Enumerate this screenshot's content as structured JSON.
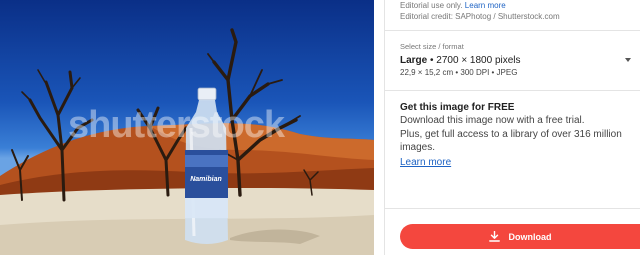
{
  "photo": {
    "watermark_text": "shutterstock",
    "bottle_label": "Namibian",
    "alt": "Water bottle in desert"
  },
  "editorial": {
    "notice": "Editorial use only.",
    "learn_more": "Learn more",
    "credit": "Editorial credit: SAPhotog / Shutterstock.com"
  },
  "size": {
    "label": "Select size / format",
    "name": "Large",
    "pixels": " • 2700 × 1800 pixels",
    "details": "22,9 × 15,2 cm • 300 DPI • JPEG"
  },
  "free": {
    "title": "Get this image for FREE",
    "line1": "Download this image now with a free trial.",
    "line2": "Plus, get full access to a library of over 316 million images.",
    "learn_more": "Learn more"
  },
  "download": {
    "label": "Download"
  },
  "colors": {
    "accent": "#f4473e",
    "link": "#1e63c4"
  }
}
